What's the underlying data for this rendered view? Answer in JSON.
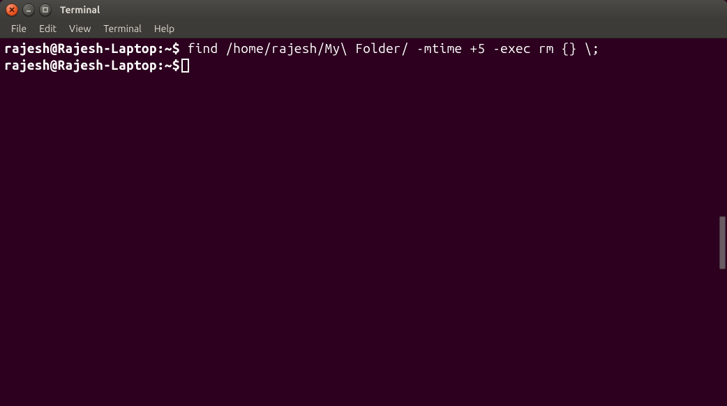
{
  "titlebar": {
    "title": "Terminal"
  },
  "menubar": {
    "items": [
      "File",
      "Edit",
      "View",
      "Terminal",
      "Help"
    ]
  },
  "prompt": {
    "user_host": "rajesh@Rajesh-Laptop",
    "path": "~",
    "symbol": "$"
  },
  "terminal": {
    "lines": [
      {
        "command": "find /home/rajesh/My\\ Folder/ -mtime +5 -exec rm {} \\;"
      },
      {
        "command": ""
      }
    ]
  }
}
